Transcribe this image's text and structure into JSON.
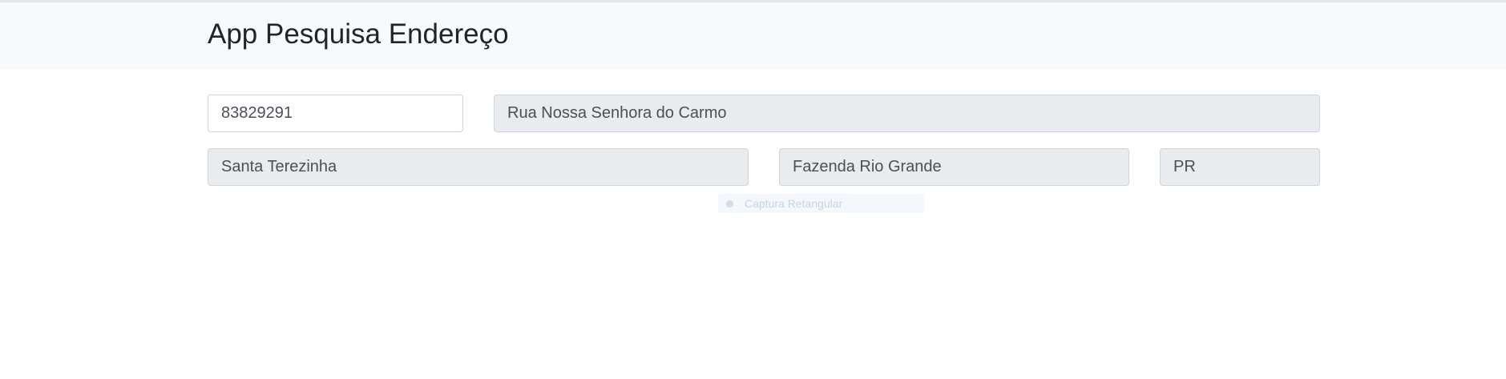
{
  "header": {
    "title": "App Pesquisa Endereço"
  },
  "form": {
    "cep": {
      "value": "83829291"
    },
    "logradouro": {
      "value": "Rua Nossa Senhora do Carmo"
    },
    "bairro": {
      "value": "Santa Terezinha"
    },
    "cidade": {
      "value": "Fazenda Rio Grande"
    },
    "uf": {
      "value": "PR"
    }
  },
  "overlay": {
    "capture_label": "Captura Retangular",
    "capture_icon": "record-dot-icon"
  },
  "colors": {
    "header_bg": "#f8f9fa",
    "readonly_bg": "#e9ecef",
    "border": "#ced4da",
    "text": "#212529"
  }
}
